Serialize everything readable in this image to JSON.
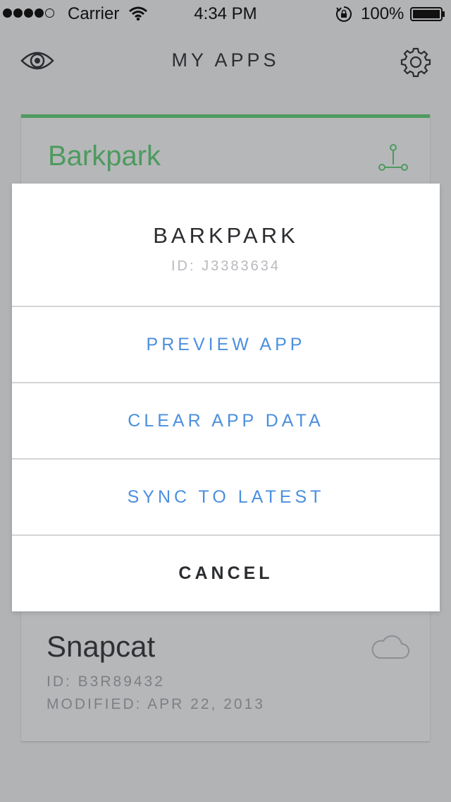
{
  "status_bar": {
    "carrier": "Carrier",
    "time": "4:34 PM",
    "battery": "100%"
  },
  "nav": {
    "title": "MY APPS",
    "left_icon": "eye-icon",
    "right_icon": "gear-icon"
  },
  "apps": [
    {
      "name": "Barkpark",
      "icon": "branch-icon",
      "accent": "#4d9a5f"
    },
    {
      "name": "Snapcat",
      "id": "ID: B3R89432",
      "modified": "MODIFIED: APR 22, 2013",
      "icon": "cloud-icon"
    }
  ],
  "sheet": {
    "title": "BARKPARK",
    "subtitle": "ID: J3383634",
    "actions": [
      {
        "label": "PREVIEW APP"
      },
      {
        "label": "CLEAR APP DATA"
      },
      {
        "label": "SYNC TO LATEST"
      }
    ],
    "cancel": "CANCEL",
    "action_color": "#4c8fdf"
  }
}
